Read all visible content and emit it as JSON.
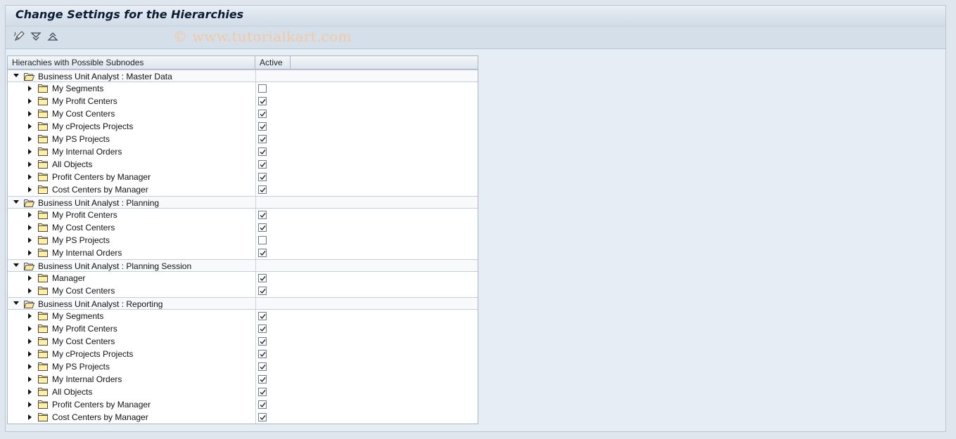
{
  "window": {
    "title": "Change Settings for the Hierarchies"
  },
  "toolbar": {
    "buttons": [
      {
        "icon": "edit-pencil-icon"
      },
      {
        "icon": "expand-all-icon"
      },
      {
        "icon": "collapse-all-icon"
      }
    ],
    "watermark": "© www.tutorialkart.com"
  },
  "tree": {
    "columns": {
      "hierarchy": "Hierachies with Possible Subnodes",
      "active": "Active"
    },
    "groups": [
      {
        "label": "Business Unit Analyst : Master Data",
        "children": [
          {
            "label": "My Segments",
            "active": false
          },
          {
            "label": "My Profit Centers",
            "active": true
          },
          {
            "label": "My Cost Centers",
            "active": true
          },
          {
            "label": "My cProjects Projects",
            "active": true
          },
          {
            "label": "My PS Projects",
            "active": true
          },
          {
            "label": "My Internal Orders",
            "active": true
          },
          {
            "label": "All Objects",
            "active": true
          },
          {
            "label": "Profit Centers by Manager",
            "active": true
          },
          {
            "label": "Cost Centers by Manager",
            "active": true
          }
        ]
      },
      {
        "label": "Business Unit Analyst : Planning",
        "children": [
          {
            "label": "My Profit Centers",
            "active": true
          },
          {
            "label": "My Cost Centers",
            "active": true
          },
          {
            "label": "My PS Projects",
            "active": false
          },
          {
            "label": "My Internal Orders",
            "active": true
          }
        ]
      },
      {
        "label": "Business Unit Analyst : Planning Session",
        "children": [
          {
            "label": "Manager",
            "active": true
          },
          {
            "label": "My Cost Centers",
            "active": true
          }
        ]
      },
      {
        "label": "Business Unit Analyst : Reporting",
        "children": [
          {
            "label": "My Segments",
            "active": true
          },
          {
            "label": "My Profit Centers",
            "active": true
          },
          {
            "label": "My Cost Centers",
            "active": true
          },
          {
            "label": "My cProjects Projects",
            "active": true
          },
          {
            "label": "My PS Projects",
            "active": true
          },
          {
            "label": "My Internal Orders",
            "active": true
          },
          {
            "label": "All Objects",
            "active": true
          },
          {
            "label": "Profit Centers by Manager",
            "active": true
          },
          {
            "label": "Cost Centers by Manager",
            "active": true
          }
        ]
      }
    ]
  }
}
